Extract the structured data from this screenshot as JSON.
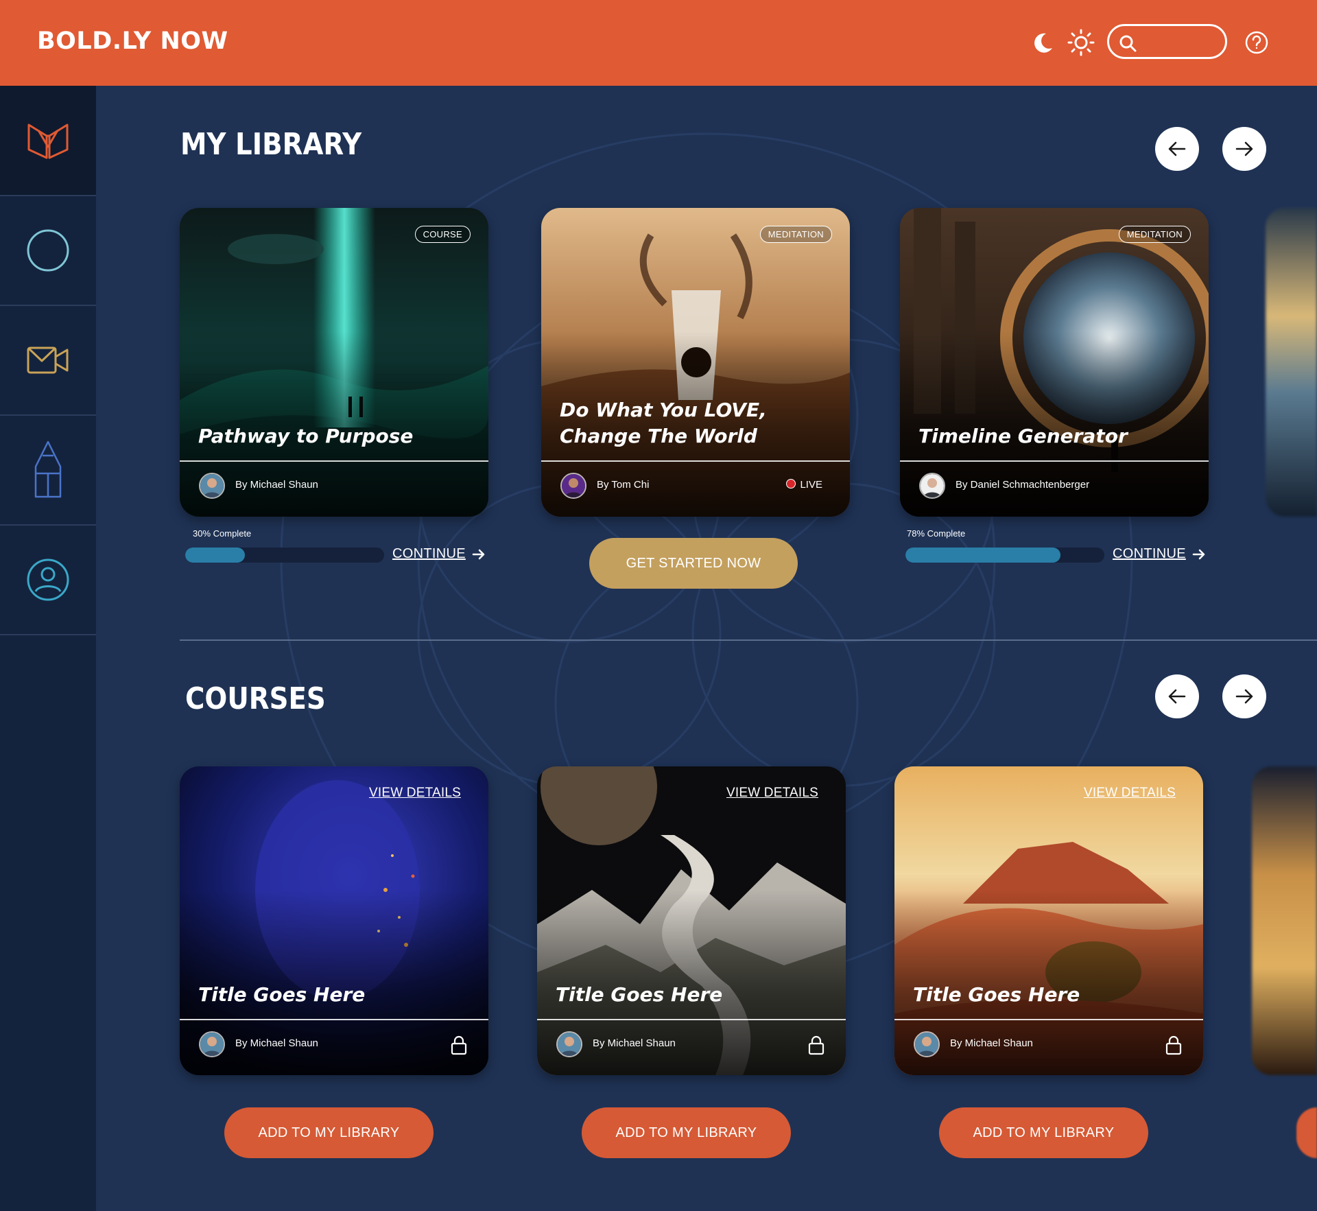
{
  "app": {
    "brand": "BOLD.LY NOW"
  },
  "header": {
    "search_placeholder": ""
  },
  "sidebar": {
    "items": [
      {
        "name": "library",
        "icon": "open-book-icon"
      },
      {
        "name": "circle",
        "icon": "circle-icon"
      },
      {
        "name": "video",
        "icon": "video-camera-icon"
      },
      {
        "name": "pencil",
        "icon": "pencil-icon"
      },
      {
        "name": "profile",
        "icon": "user-profile-icon"
      }
    ]
  },
  "library": {
    "title": "MY LIBRARY",
    "cards": [
      {
        "badge": "COURSE",
        "title": "Pathway to Purpose",
        "author": "By Michael Shaun",
        "progress_label": "30% Complete",
        "progress": 30,
        "action": "CONTINUE"
      },
      {
        "badge": "MEDITATION",
        "title": "Do What You LOVE, Change The World",
        "author": "By Tom Chi",
        "live": "LIVE",
        "action": "GET STARTED NOW"
      },
      {
        "badge": "MEDITATION",
        "title": "Timeline Generator",
        "author": "By Daniel Schmachtenberger",
        "progress_label": "78% Complete",
        "progress": 78,
        "action": "CONTINUE"
      }
    ]
  },
  "courses": {
    "title": "COURSES",
    "cards": [
      {
        "view": "VIEW DETAILS",
        "title": "Title Goes Here",
        "author": "By Michael Shaun",
        "action": "ADD TO MY LIBRARY"
      },
      {
        "view": "VIEW DETAILS",
        "title": "Title Goes Here",
        "author": "By Michael Shaun",
        "action": "ADD TO MY LIBRARY"
      },
      {
        "view": "VIEW DETAILS",
        "title": "Title Goes Here",
        "author": "By Michael Shaun",
        "action": "ADD TO MY LIBRARY"
      }
    ]
  },
  "colors": {
    "header": "#e05a33",
    "background": "#1f3254",
    "sidebar": "#14233d",
    "progress": "#2a7fa8",
    "gold": "#c4a05e",
    "orange_button": "#d65a35"
  }
}
